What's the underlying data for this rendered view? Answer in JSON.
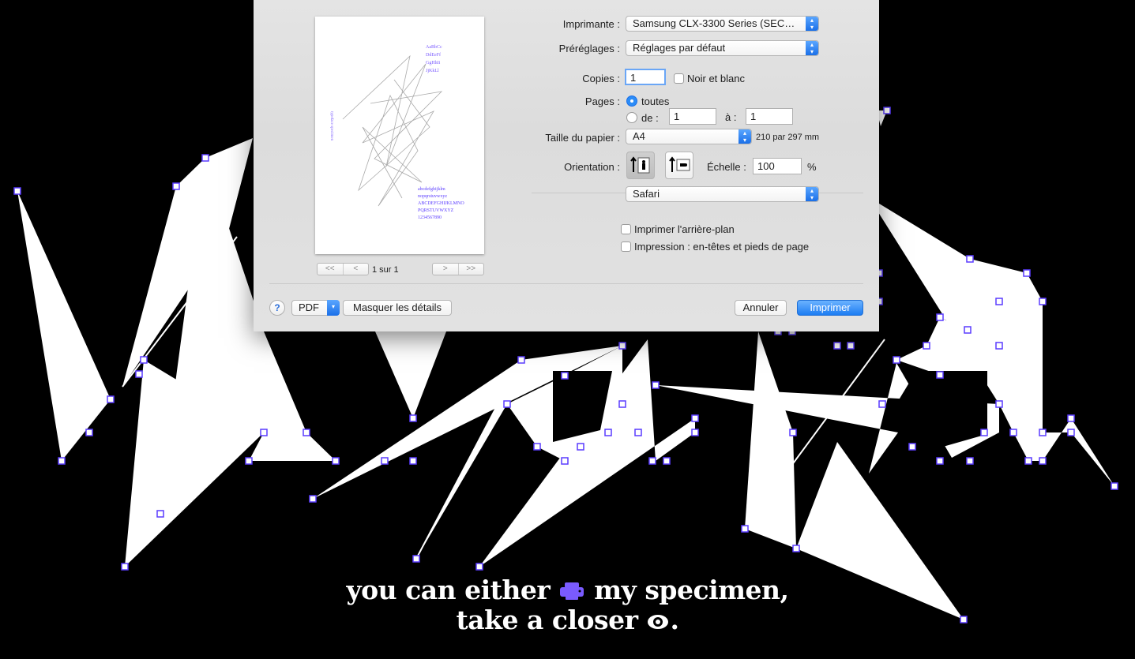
{
  "caption": {
    "line1_a": "you can either",
    "line1_b": "my specimen,",
    "line2_a": "take a closer",
    "line2_b": "."
  },
  "colors": {
    "accent": "#7a5bff",
    "handle_stroke": "#5a3cff",
    "primary_button": "#1d7cf2"
  },
  "icons": {
    "printer": "printer-icon",
    "eye": "eye-icon",
    "help": "question-mark-icon"
  },
  "dialog": {
    "printer_label": "Imprimante :",
    "printer_value": "Samsung CLX-3300 Series (SEC…",
    "presets_label": "Préréglages :",
    "presets_value": "Réglages par défaut",
    "copies_label": "Copies :",
    "copies_value": "1",
    "bw_label": "Noir et blanc",
    "pages_label": "Pages :",
    "pages_all": "toutes",
    "pages_from": "de :",
    "pages_from_value": "1",
    "pages_to": "à :",
    "pages_to_value": "1",
    "paper_label": "Taille du papier :",
    "paper_value": "A4",
    "paper_dims": "210 par 297 mm",
    "orientation_label": "Orientation :",
    "scale_label": "Échelle :",
    "scale_value": "100",
    "scale_unit": "%",
    "app_value": "Safari",
    "print_bg_label": "Imprimer l'arrière-plan",
    "headers_label": "Impression : en-têtes et pieds de page",
    "page_count": "1 sur 1",
    "pager_first": "<<",
    "pager_prev": "<",
    "pager_next": ">",
    "pager_last": ">>",
    "help_label": "?",
    "pdf_label": "PDF",
    "hide_details": "Masquer les détails",
    "cancel": "Annuler",
    "print": "Imprimer"
  },
  "preview_text": {
    "lines": [
      "abcdefghijklm",
      "nopqrstuvwxyz",
      "ABCDEFGHIJKLMNO",
      "PQRSTUVWXYZ",
      "1234567890"
    ],
    "side": "Jean-Baptiste Levée · Typeface"
  }
}
